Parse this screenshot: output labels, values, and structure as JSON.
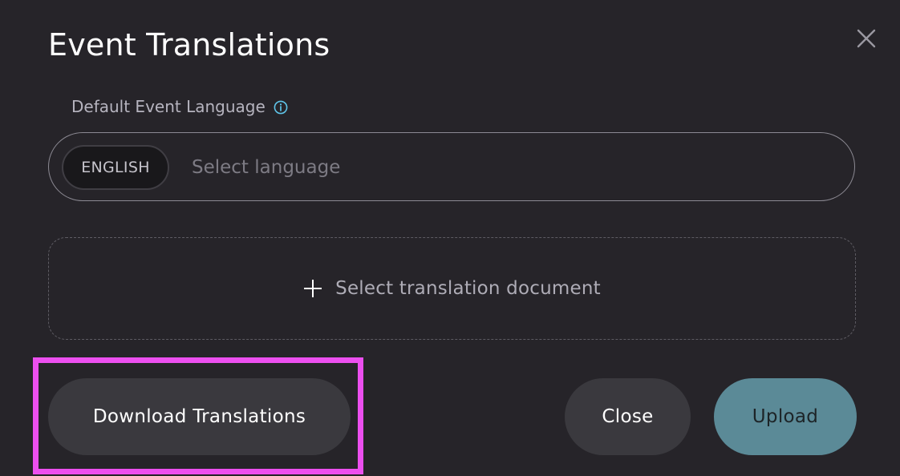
{
  "dialog": {
    "title": "Event Translations"
  },
  "language": {
    "label": "Default Event Language",
    "selected_chip": "ENGLISH",
    "placeholder": "Select language"
  },
  "upload": {
    "dropzone_label": "Select translation document"
  },
  "actions": {
    "download_label": "Download Translations",
    "close_label": "Close",
    "upload_label": "Upload"
  },
  "colors": {
    "background": "#262429",
    "secondary_button": "#3a393e",
    "primary_button": "#5b8a97",
    "info_icon": "#5fc4e8",
    "highlight": "#ec4fef"
  },
  "icons": {
    "close": "close-icon",
    "info": "info-icon",
    "add": "plus-icon"
  }
}
